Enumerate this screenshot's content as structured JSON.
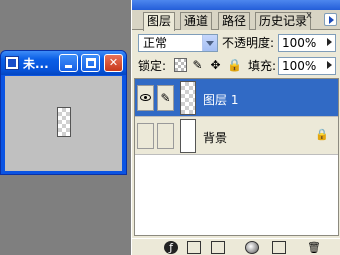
{
  "document_window": {
    "title": "未..."
  },
  "panel": {
    "tabs": [
      {
        "label": "图层",
        "active": true
      },
      {
        "label": "通道",
        "active": false
      },
      {
        "label": "路径",
        "active": false
      },
      {
        "label": "历史记录",
        "active": false
      }
    ],
    "close_glyph": "x",
    "blend_mode": "正常",
    "opacity_label": "不透明度:",
    "opacity_value": "100%",
    "lock_label": "锁定:",
    "fill_label": "填充:",
    "fill_value": "100%",
    "layers": [
      {
        "name": "图层 1",
        "selected": true,
        "visible": true,
        "thumbnail": "transparent-checker"
      },
      {
        "name": "背景",
        "selected": false,
        "visible": false,
        "locked": true,
        "thumbnail": "white"
      }
    ],
    "bottom_icons": [
      "link-icon",
      "layer-style-icon",
      "mask-icon",
      "adjustment-icon",
      "new-layer-icon",
      "trash-icon"
    ]
  },
  "colors": {
    "xp_titlebar": "#0b5fe6",
    "selection": "#316ac5",
    "panel_bg": "#ece9d8",
    "workspace": "#7f7f7f"
  }
}
